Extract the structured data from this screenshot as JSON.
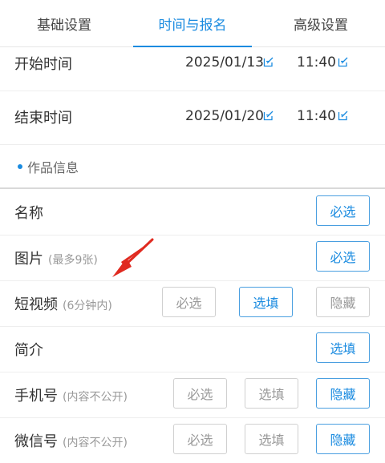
{
  "tabs": [
    {
      "label": "基础设置"
    },
    {
      "label": "时间与报名"
    },
    {
      "label": "高级设置"
    }
  ],
  "time": {
    "start": {
      "label": "开始时间",
      "date": "2025/01/13",
      "time": "11:40"
    },
    "end": {
      "label": "结束时间",
      "date": "2025/01/20",
      "time": "11:40"
    }
  },
  "section": {
    "title": "作品信息"
  },
  "fields": [
    {
      "label": "名称",
      "note": "",
      "options": [
        "必选"
      ],
      "selected": "必选"
    },
    {
      "label": "图片",
      "note": "(最多9张)",
      "options": [
        "必选"
      ],
      "selected": "必选"
    },
    {
      "label": "短视频",
      "note": "(6分钟内)",
      "options": [
        "必选",
        "选填",
        "隐藏"
      ],
      "selected": "选填"
    },
    {
      "label": "简介",
      "note": "",
      "options": [
        "选填"
      ],
      "selected": "选填"
    },
    {
      "label": "手机号",
      "note": "(内容不公开)",
      "options": [
        "必选",
        "选填",
        "隐藏"
      ],
      "selected": "隐藏"
    },
    {
      "label": "微信号",
      "note": "(内容不公开)",
      "options": [
        "必选",
        "选填",
        "隐藏"
      ],
      "selected": "隐藏"
    }
  ],
  "colors": {
    "accent": "#1a8be0",
    "annotation_arrow": "#e02a20"
  }
}
